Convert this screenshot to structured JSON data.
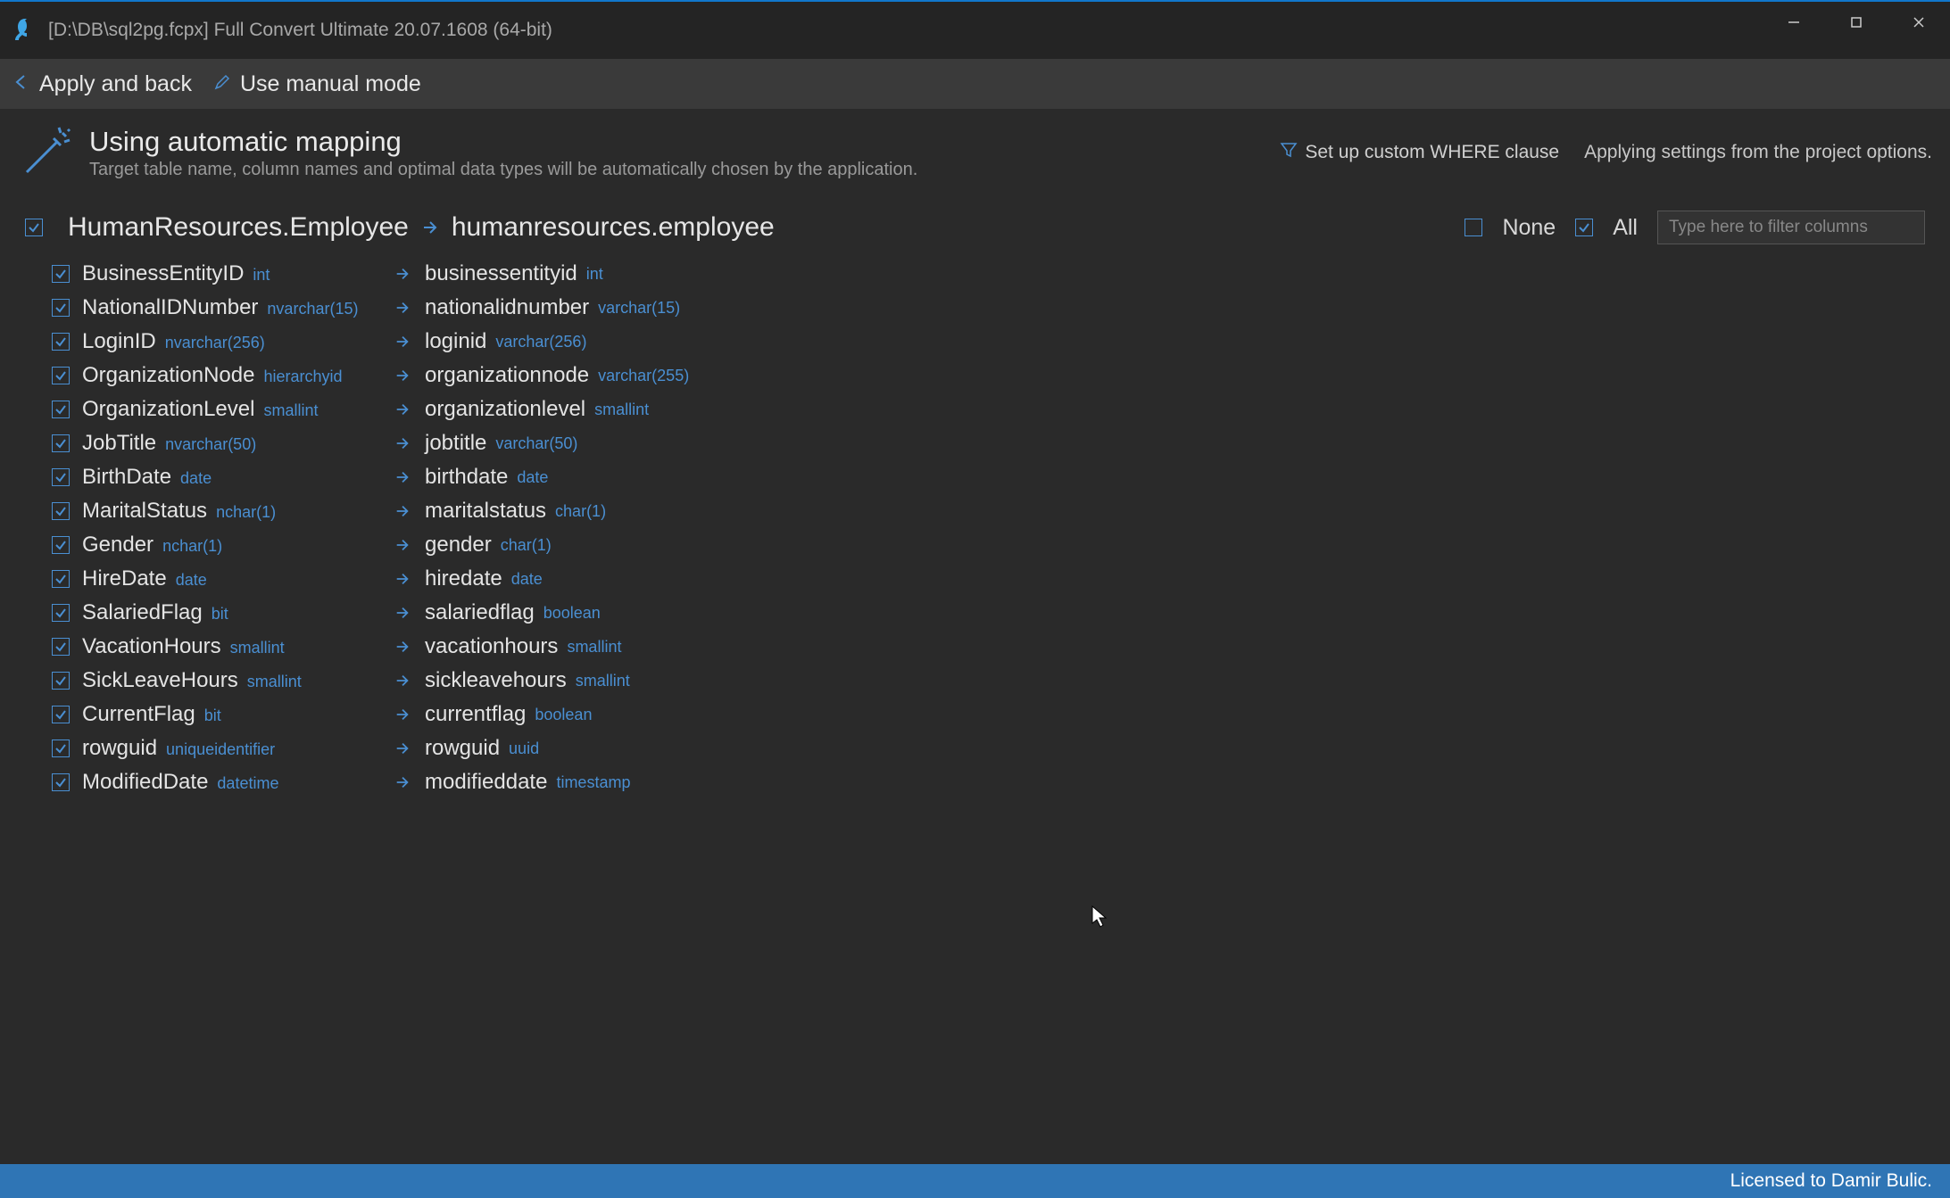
{
  "window": {
    "title": "[D:\\DB\\sql2pg.fcpx] Full Convert Ultimate 20.07.1608 (64-bit)"
  },
  "toolbar": {
    "apply_back": "Apply and back",
    "manual_mode": "Use manual mode"
  },
  "header": {
    "title": "Using automatic mapping",
    "subtitle": "Target table name, column names and optimal data types will be automatically chosen by the application.",
    "where_clause": "Set up custom WHERE clause",
    "applying": "Applying settings from the project options."
  },
  "table_map": {
    "source": "HumanResources.Employee",
    "target": "humanresources.employee"
  },
  "selectors": {
    "none": "None",
    "all": "All",
    "filter_placeholder": "Type here to filter columns"
  },
  "columns": [
    {
      "src": "BusinessEntityID",
      "stype": "int",
      "tgt": "businessentityid",
      "ttype": "int"
    },
    {
      "src": "NationalIDNumber",
      "stype": "nvarchar(15)",
      "tgt": "nationalidnumber",
      "ttype": "varchar(15)"
    },
    {
      "src": "LoginID",
      "stype": "nvarchar(256)",
      "tgt": "loginid",
      "ttype": "varchar(256)"
    },
    {
      "src": "OrganizationNode",
      "stype": "hierarchyid",
      "tgt": "organizationnode",
      "ttype": "varchar(255)"
    },
    {
      "src": "OrganizationLevel",
      "stype": "smallint",
      "tgt": "organizationlevel",
      "ttype": "smallint"
    },
    {
      "src": "JobTitle",
      "stype": "nvarchar(50)",
      "tgt": "jobtitle",
      "ttype": "varchar(50)"
    },
    {
      "src": "BirthDate",
      "stype": "date",
      "tgt": "birthdate",
      "ttype": "date"
    },
    {
      "src": "MaritalStatus",
      "stype": "nchar(1)",
      "tgt": "maritalstatus",
      "ttype": "char(1)"
    },
    {
      "src": "Gender",
      "stype": "nchar(1)",
      "tgt": "gender",
      "ttype": "char(1)"
    },
    {
      "src": "HireDate",
      "stype": "date",
      "tgt": "hiredate",
      "ttype": "date"
    },
    {
      "src": "SalariedFlag",
      "stype": "bit",
      "tgt": "salariedflag",
      "ttype": "boolean"
    },
    {
      "src": "VacationHours",
      "stype": "smallint",
      "tgt": "vacationhours",
      "ttype": "smallint"
    },
    {
      "src": "SickLeaveHours",
      "stype": "smallint",
      "tgt": "sickleavehours",
      "ttype": "smallint"
    },
    {
      "src": "CurrentFlag",
      "stype": "bit",
      "tgt": "currentflag",
      "ttype": "boolean"
    },
    {
      "src": "rowguid",
      "stype": "uniqueidentifier",
      "tgt": "rowguid",
      "ttype": "uuid"
    },
    {
      "src": "ModifiedDate",
      "stype": "datetime",
      "tgt": "modifieddate",
      "ttype": "timestamp"
    }
  ],
  "status": {
    "license": "Licensed to Damir Bulic."
  }
}
